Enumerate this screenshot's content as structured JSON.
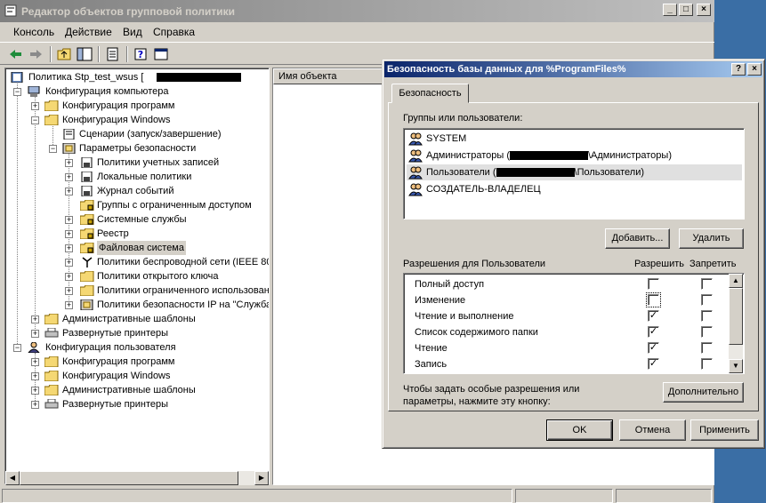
{
  "main": {
    "title": "Редактор объектов групповой политики",
    "menu": [
      {
        "label": "Консоль",
        "u": "К"
      },
      {
        "label": "Действие",
        "u": "Д"
      },
      {
        "label": "Вид",
        "u": "В"
      },
      {
        "label": "Справка",
        "u": "С"
      }
    ],
    "list_column": "Имя объекта"
  },
  "tree": {
    "root": "Политика Stp_test_wsus [",
    "computer_config": "Конфигурация компьютера",
    "cc_programs": "Конфигурация программ",
    "cc_windows": "Конфигурация Windows",
    "scripts": "Сценарии (запуск/завершение)",
    "security": "Параметры безопасности",
    "account_policies": "Политики учетных записей",
    "local_policies": "Локальные политики",
    "event_log": "Журнал событий",
    "restricted_groups": "Группы с ограниченным доступом",
    "system_services": "Системные службы",
    "registry": "Реестр",
    "file_system": "Файловая система",
    "wireless": "Политики беспроводной сети (IEEE 80",
    "public_key": "Политики открытого ключа",
    "software_restriction": "Политики ограниченного использован",
    "ip_security": "Политики безопасности IP на \"Служба",
    "admin_templates": "Административные шаблоны",
    "printers": "Развернутые принтеры",
    "user_config": "Конфигурация пользователя",
    "uc_programs": "Конфигурация программ",
    "uc_windows": "Конфигурация Windows",
    "uc_admin_templates": "Административные шаблоны",
    "uc_printers": "Развернутые принтеры"
  },
  "dialog": {
    "title": "Безопасность базы данных для %ProgramFiles%",
    "tab": "Безопасность",
    "groups_label": "Группы или пользователи:",
    "groups": [
      {
        "pre": "SYSTEM",
        "post": ""
      },
      {
        "pre": "Администраторы (",
        "post": "\\Администраторы)"
      },
      {
        "pre": "Пользователи (",
        "post": "\\Пользователи)"
      },
      {
        "pre": "СОЗДАТЕЛЬ-ВЛАДЕЛЕЦ",
        "post": ""
      }
    ],
    "add_btn": "Добавить...",
    "remove_btn": "Удалить",
    "perm_label": "Разрешения для Пользователи",
    "allow_col": "Разрешить",
    "deny_col": "Запретить",
    "permissions": [
      {
        "name": "Полный доступ",
        "allow": "",
        "deny": ""
      },
      {
        "name": "Изменение",
        "allow": "",
        "deny": ""
      },
      {
        "name": "Чтение и выполнение",
        "allow": "✓",
        "deny": ""
      },
      {
        "name": "Список содержимого папки",
        "allow": "✓",
        "deny": ""
      },
      {
        "name": "Чтение",
        "allow": "✓",
        "deny": ""
      },
      {
        "name": "Запись",
        "allow": "✓",
        "deny": ""
      }
    ],
    "advanced_text1": "Чтобы задать особые разрешения или",
    "advanced_text2": "параметры, нажмите эту кнопку:",
    "advanced_btn": "Дополнительно",
    "ok_btn": "OK",
    "cancel_btn": "Отмена",
    "apply_btn": "Применить"
  }
}
